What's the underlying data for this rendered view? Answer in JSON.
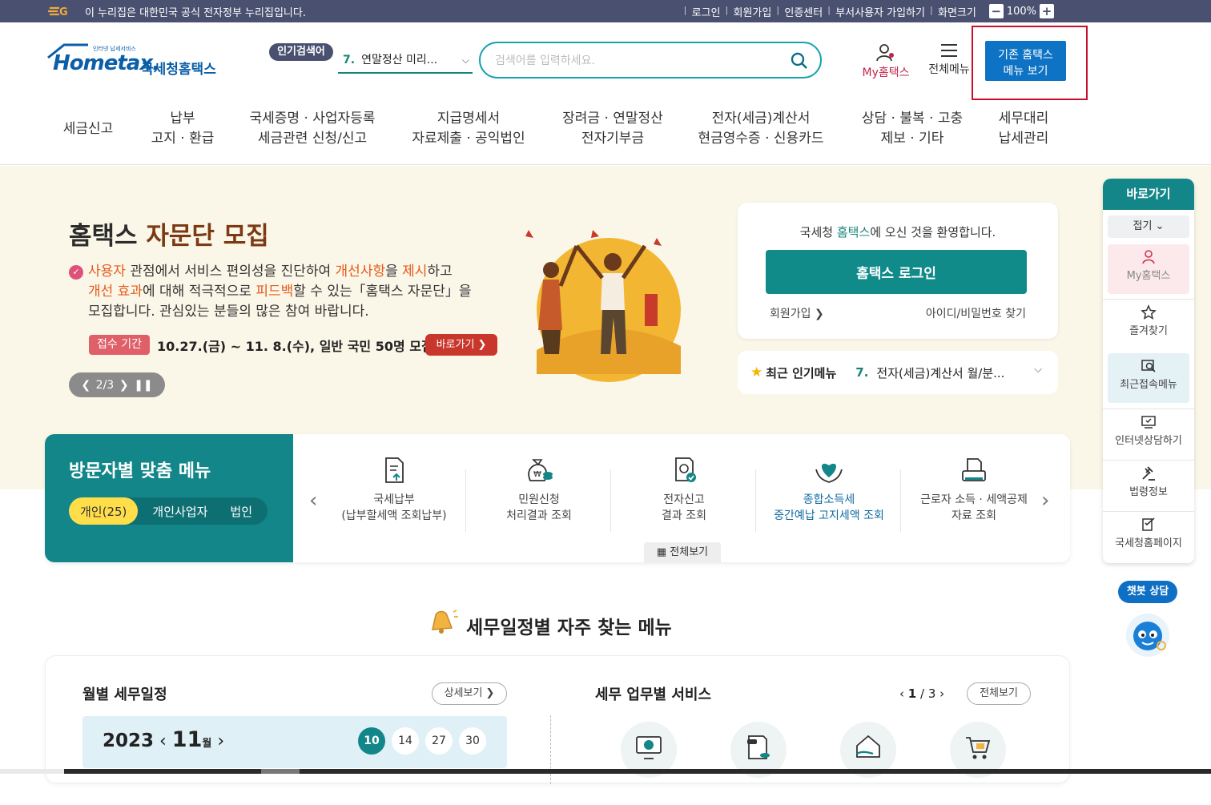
{
  "gov_bar": {
    "notice": "이 누리집은 대한민국 공식 전자정부 누리집입니다.",
    "links": [
      "로그인",
      "회원가입",
      "인증센터",
      "부서사용자 가입하기",
      "화면크기"
    ],
    "zoom_minus": "−",
    "zoom_level": "100%",
    "zoom_plus": "+"
  },
  "header": {
    "logo_sub": "인터넷 납세서비스",
    "logo_en": "Hometax.",
    "logo_ko": "국세청홈택스",
    "popular_badge": "인기검색어",
    "popular_num": "7.",
    "popular_term": "연말정산 미리...",
    "search_placeholder": "검색어를 입력하세요.",
    "my_hometax": "My홈택스",
    "all_menu": "전체메뉴",
    "old_view_line1": "기존 홈택스",
    "old_view_line2": "메뉴 보기"
  },
  "gnb": [
    "세금신고",
    "납부\n고지 · 환급",
    "국세증명 · 사업자등록\n세금관련 신청/신고",
    "지급명세서\n자료제출 · 공익법인",
    "장려금 · 연말정산\n전자기부금",
    "전자(세금)계산서\n현금영수증 · 신용카드",
    "상담 · 불복 · 고충\n제보 · 기타",
    "세무대리\n납세관리"
  ],
  "hero": {
    "title_plain": "홈택스 ",
    "title_highlight": "자문단 모집",
    "line1_a": "사용자",
    "line1_b": " 관점에서 서비스 편의성을 진단하여 ",
    "line1_c": "개선사항",
    "line1_d": "을 ",
    "line1_e": "제시",
    "line1_f": "하고",
    "line2_a": "개선 효과",
    "line2_b": "에 대해 적극적으로 ",
    "line2_c": "피드백",
    "line2_d": "할 수 있는「홈택스 자문단」을",
    "line3": "모집합니다. 관심있는 분들의 많은 참여 바랍니다.",
    "period_badge": "접수 기간",
    "period_text": "10.27.(금) ~ 11. 8.(수), 일반 국민 50명 모집",
    "go_button": "바로가기 ❯",
    "pager_prev": "❮",
    "pager_text": "2/3",
    "pager_next": "❯",
    "pager_pause": "❚❚"
  },
  "login": {
    "welcome_a": "국세청 ",
    "welcome_b": "홈택스",
    "welcome_c": "에 오신 것을 환영합니다.",
    "login_button": "홈택스 로그인",
    "join": "회원가입 ❯",
    "find": "아이디/비밀번호 찾기"
  },
  "popular_menu": {
    "label": "최근 인기메뉴",
    "num": "7.",
    "text": "전자(세금)계산서 월/분..."
  },
  "visitor": {
    "title": "방문자별 맞춤 메뉴",
    "tabs": [
      "개인(25)",
      "개인사업자",
      "법인"
    ],
    "items": [
      {
        "line1": "국세납부",
        "line2": "(납부할세액 조회납부)"
      },
      {
        "line1": "민원신청",
        "line2": "처리결과 조회"
      },
      {
        "line1": "전자신고",
        "line2": "결과 조회"
      },
      {
        "line1": "종합소득세",
        "line2": "중간예납 고지세액 조회"
      },
      {
        "line1": "근로자 소득 · 세액공제",
        "line2": "자료 조회"
      }
    ],
    "view_all": "전체보기"
  },
  "schedule": {
    "section_title": "세무일정별 자주 찾는 메뉴",
    "monthly_title": "월별 세무일정",
    "detail_button": "상세보기 ❯",
    "year": "2023",
    "month": "11",
    "month_unit": "월",
    "days": [
      "10",
      "14",
      "27",
      "30"
    ],
    "service_title": "세무 업무별 서비스",
    "page_current": "1",
    "page_total": "/ 3",
    "all_button": "전체보기"
  },
  "quick": {
    "title": "바로가기",
    "fold": "접기 ⌄",
    "items": [
      "My홈택스",
      "즐겨찾기",
      "최근접속메뉴",
      "인터넷상담하기",
      "법령정보",
      "국세청홈페이지"
    ]
  },
  "chat": {
    "label": "챗봇 상담"
  },
  "colors": {
    "teal": "#13868a",
    "gov_bar": "#4a5170",
    "highlight_box": "#c8102e",
    "old_view_button": "#0e73c4"
  }
}
